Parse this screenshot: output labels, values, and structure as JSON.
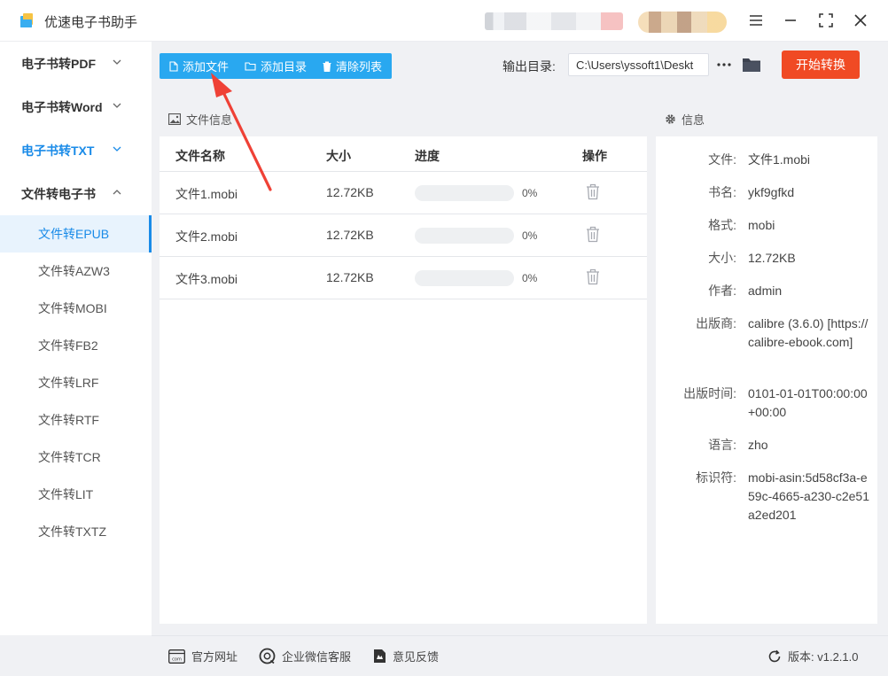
{
  "app": {
    "title": "优速电子书助手"
  },
  "sidebar": {
    "groups": [
      {
        "label": "电子书转PDF"
      },
      {
        "label": "电子书转Word"
      },
      {
        "label": "电子书转TXT"
      },
      {
        "label": "文件转电子书"
      }
    ],
    "sub_items": [
      {
        "label": "文件转EPUB"
      },
      {
        "label": "文件转AZW3"
      },
      {
        "label": "文件转MOBI"
      },
      {
        "label": "文件转FB2"
      },
      {
        "label": "文件转LRF"
      },
      {
        "label": "文件转RTF"
      },
      {
        "label": "文件转TCR"
      },
      {
        "label": "文件转LIT"
      },
      {
        "label": "文件转TXTZ"
      }
    ]
  },
  "toolbar": {
    "add_file": "添加文件",
    "add_folder": "添加目录",
    "clear_list": "清除列表",
    "output_label": "输出目录:",
    "output_path": "C:\\Users\\yssoft1\\Deskt",
    "start": "开始转换"
  },
  "file_panel": {
    "title": "文件信息",
    "columns": [
      "文件名称",
      "大小",
      "进度",
      "操作"
    ],
    "rows": [
      {
        "name": "文件1.mobi",
        "size": "12.72KB",
        "progress": 0,
        "progress_label": "0%"
      },
      {
        "name": "文件2.mobi",
        "size": "12.72KB",
        "progress": 0,
        "progress_label": "0%"
      },
      {
        "name": "文件3.mobi",
        "size": "12.72KB",
        "progress": 0,
        "progress_label": "0%"
      }
    ]
  },
  "info_panel": {
    "title": "信息",
    "fields": [
      {
        "key": "文件:",
        "value": "文件1.mobi"
      },
      {
        "key": "书名:",
        "value": "ykf9gfkd"
      },
      {
        "key": "格式:",
        "value": "mobi"
      },
      {
        "key": "大小:",
        "value": "12.72KB"
      },
      {
        "key": "作者:",
        "value": "admin"
      },
      {
        "key": "出版商:",
        "value": "calibre (3.6.0) [https://calibre-ebook.com]"
      },
      {
        "key": "出版时间:",
        "value": "0101-01-01T00:00:00+00:00"
      },
      {
        "key": "语言:",
        "value": "zho"
      },
      {
        "key": "标识符:",
        "value": "mobi-asin:5d58cf3a-e59c-4665-a230-c2e51a2ed201"
      }
    ]
  },
  "footer": {
    "website": "官方网址",
    "wechat": "企业微信客服",
    "feedback": "意见反馈",
    "version": "版本:  v1.2.1.0"
  },
  "colors": {
    "accent": "#29a8f0",
    "active_text": "#1a8be8",
    "start_button": "#f04a24",
    "annotation_arrow": "#ef4136"
  },
  "icons": [
    "window-menu-icon",
    "minimize-icon",
    "fullscreen-icon",
    "close-icon",
    "file-icon",
    "folder-icon",
    "trash-icon",
    "more-icon",
    "image-icon",
    "gear-icon",
    "refresh-icon"
  ]
}
